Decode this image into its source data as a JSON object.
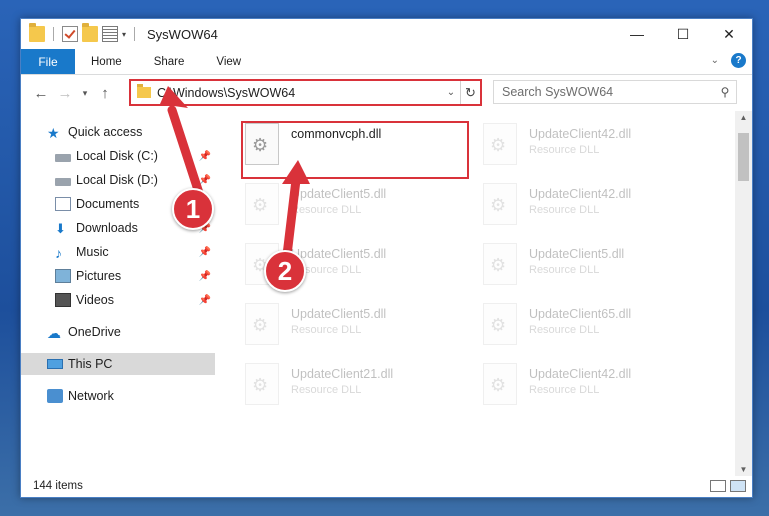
{
  "window": {
    "title": "SysWOW64",
    "controls": {
      "minimize": "—",
      "maximize": "☐",
      "close": "✕"
    }
  },
  "ribbon": {
    "file_tab": "File",
    "tabs": [
      "Home",
      "Share",
      "View"
    ]
  },
  "address": {
    "path": "C:\\Windows\\SysWOW64"
  },
  "search": {
    "placeholder": "Search SysWOW64"
  },
  "sidebar": {
    "items": [
      {
        "label": "Quick access",
        "icon": "star-icon"
      },
      {
        "label": "Local Disk (C:)",
        "icon": "drive-icon",
        "pinned": true
      },
      {
        "label": "Local Disk (D:)",
        "icon": "drive-icon",
        "pinned": true
      },
      {
        "label": "Documents",
        "icon": "documents-icon",
        "pinned": true
      },
      {
        "label": "Downloads",
        "icon": "download-icon",
        "pinned": true
      },
      {
        "label": "Music",
        "icon": "music-icon",
        "pinned": true
      },
      {
        "label": "Pictures",
        "icon": "pictures-icon",
        "pinned": true
      },
      {
        "label": "Videos",
        "icon": "videos-icon",
        "pinned": true
      },
      {
        "label": "OneDrive",
        "icon": "cloud-icon"
      },
      {
        "label": "This PC",
        "icon": "computer-icon",
        "selected": true
      },
      {
        "label": "Network",
        "icon": "network-icon"
      }
    ]
  },
  "files": {
    "items": [
      {
        "name": "commonvcph.dll",
        "type": ""
      },
      {
        "name": "UpdateClient42.dll",
        "type": "Resource DLL"
      },
      {
        "name": "UpdateClient5.dll",
        "type": "Resource DLL"
      },
      {
        "name": "UpdateClient42.dll",
        "type": "Resource DLL"
      },
      {
        "name": "UpdateClient5.dll",
        "type": "Resource DLL"
      },
      {
        "name": "UpdateClient5.dll",
        "type": "Resource DLL"
      },
      {
        "name": "UpdateClient5.dll",
        "type": "Resource DLL"
      },
      {
        "name": "UpdateClient65.dll",
        "type": "Resource DLL"
      },
      {
        "name": "UpdateClient21.dll",
        "type": "Resource DLL"
      },
      {
        "name": "UpdateClient42.dll",
        "type": "Resource DLL"
      }
    ]
  },
  "status": {
    "count": "144 items"
  },
  "annotations": {
    "step1": "1",
    "step2": "2",
    "accent_color": "#d9323a"
  },
  "colors": {
    "file_tab": "#1979ca",
    "selected_nav": "#d9d9d9"
  }
}
